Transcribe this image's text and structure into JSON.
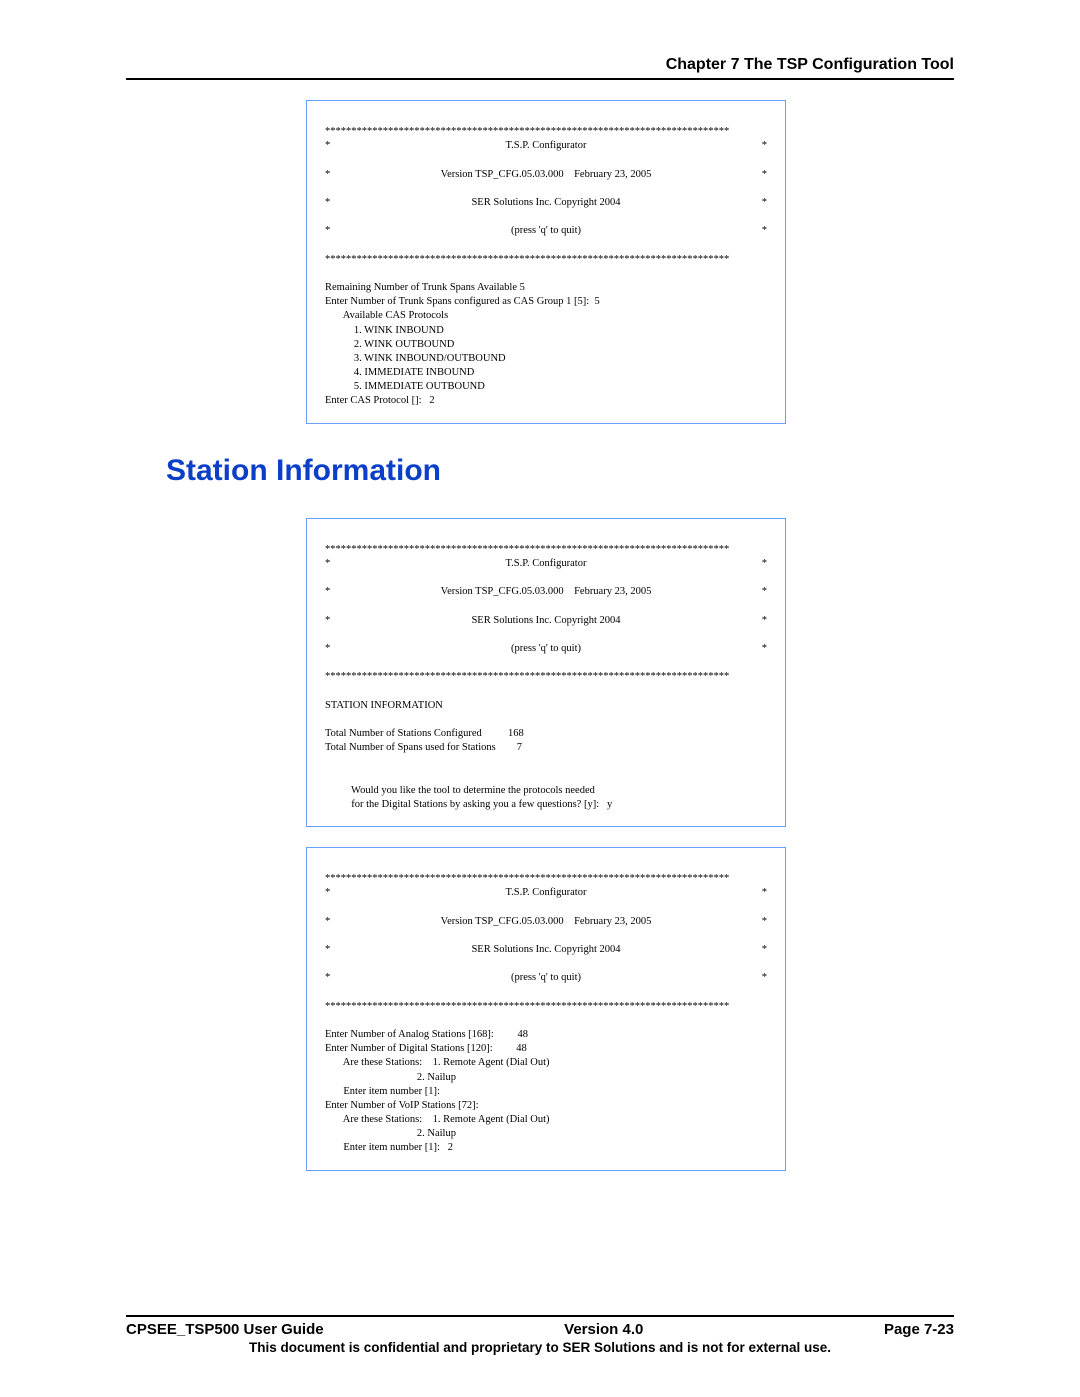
{
  "header": {
    "chapter": "Chapter 7 The TSP Configuration Tool"
  },
  "section": {
    "title": "Station Information"
  },
  "banner": {
    "starline": "*****************************************************************************",
    "l1": "T.S.P. Configurator",
    "l2": "Version TSP_CFG.05.03.000    February 23, 2005",
    "l3": "SER Solutions Inc. Copyright 2004",
    "l4": "(press 'q' to quit)",
    "star": "*"
  },
  "box1": {
    "a": "Remaining Number of Trunk Spans Available 5",
    "b": "Enter Number of Trunk Spans configured as CAS Group 1 [5]:  5",
    "c": "       Available CAS Protocols",
    "d": "           1. WINK INBOUND",
    "e": "           2. WINK OUTBOUND",
    "f": "           3. WINK INBOUND/OUTBOUND",
    "g": "           4. IMMEDIATE INBOUND",
    "h": "           5. IMMEDIATE OUTBOUND",
    "i": "Enter CAS Protocol []:   2"
  },
  "box2": {
    "a": "STATION INFORMATION",
    "b": "Total Number of Stations Configured          168",
    "c": "Total Number of Spans used for Stations        7",
    "d": "          Would you like the tool to determine the protocols needed",
    "e": "          for the Digital Stations by asking you a few questions? [y]:   y"
  },
  "box3": {
    "a": "Enter Number of Analog Stations [168]:         48",
    "b": "Enter Number of Digital Stations [120]:         48",
    "c": "       Are these Stations:    1. Remote Agent (Dial Out)",
    "d": "                                   2. Nailup",
    "e": "       Enter item number [1]:",
    "f": "Enter Number of VoIP Stations [72]:",
    "g": "       Are these Stations:    1. Remote Agent (Dial Out)",
    "h": "                                   2. Nailup",
    "i": "       Enter item number [1]:   2"
  },
  "footer": {
    "left": "CPSEE_TSP500 User Guide",
    "center": "Version 4.0",
    "right": "Page 7-23",
    "note": "This document is confidential and proprietary to SER Solutions and is not for external use."
  }
}
